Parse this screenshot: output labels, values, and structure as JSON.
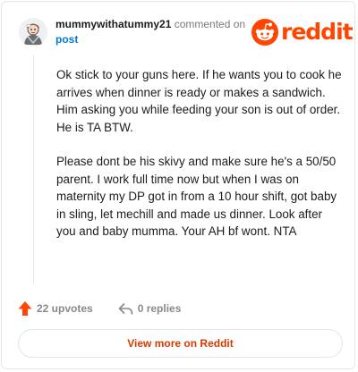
{
  "comment": {
    "username": "mummywithatummy21",
    "action_text": " commented on ",
    "post_link": "post",
    "avatar_icon": "avatar-icon",
    "paragraphs": [
      "Ok stick to your guns here. If he wants you to cook he arrives when dinner is ready or makes a sandwich. Him asking you while feeding your son is out of order. He is TA BTW.",
      "Please dont be his skivy and make sure he's a 50/50 parent. I work full time now but when I was on maternity my DP got in from a 10 hour shift, got baby in sling, let mechill and made us dinner. Look after you and baby mumma. Your AH bf wont. NTA"
    ]
  },
  "brand": {
    "logo_text": "reddit",
    "color": "#ff4500",
    "icon": "reddit-alien-icon"
  },
  "footer": {
    "upvotes": "22 upvotes",
    "upvote_icon": "upvote-arrow-icon",
    "upvote_color": "#ff4500",
    "replies": "0 replies",
    "reply_icon": "reply-arrow-icon",
    "view_more": "View more on Reddit",
    "view_more_color": "#d93a00"
  }
}
